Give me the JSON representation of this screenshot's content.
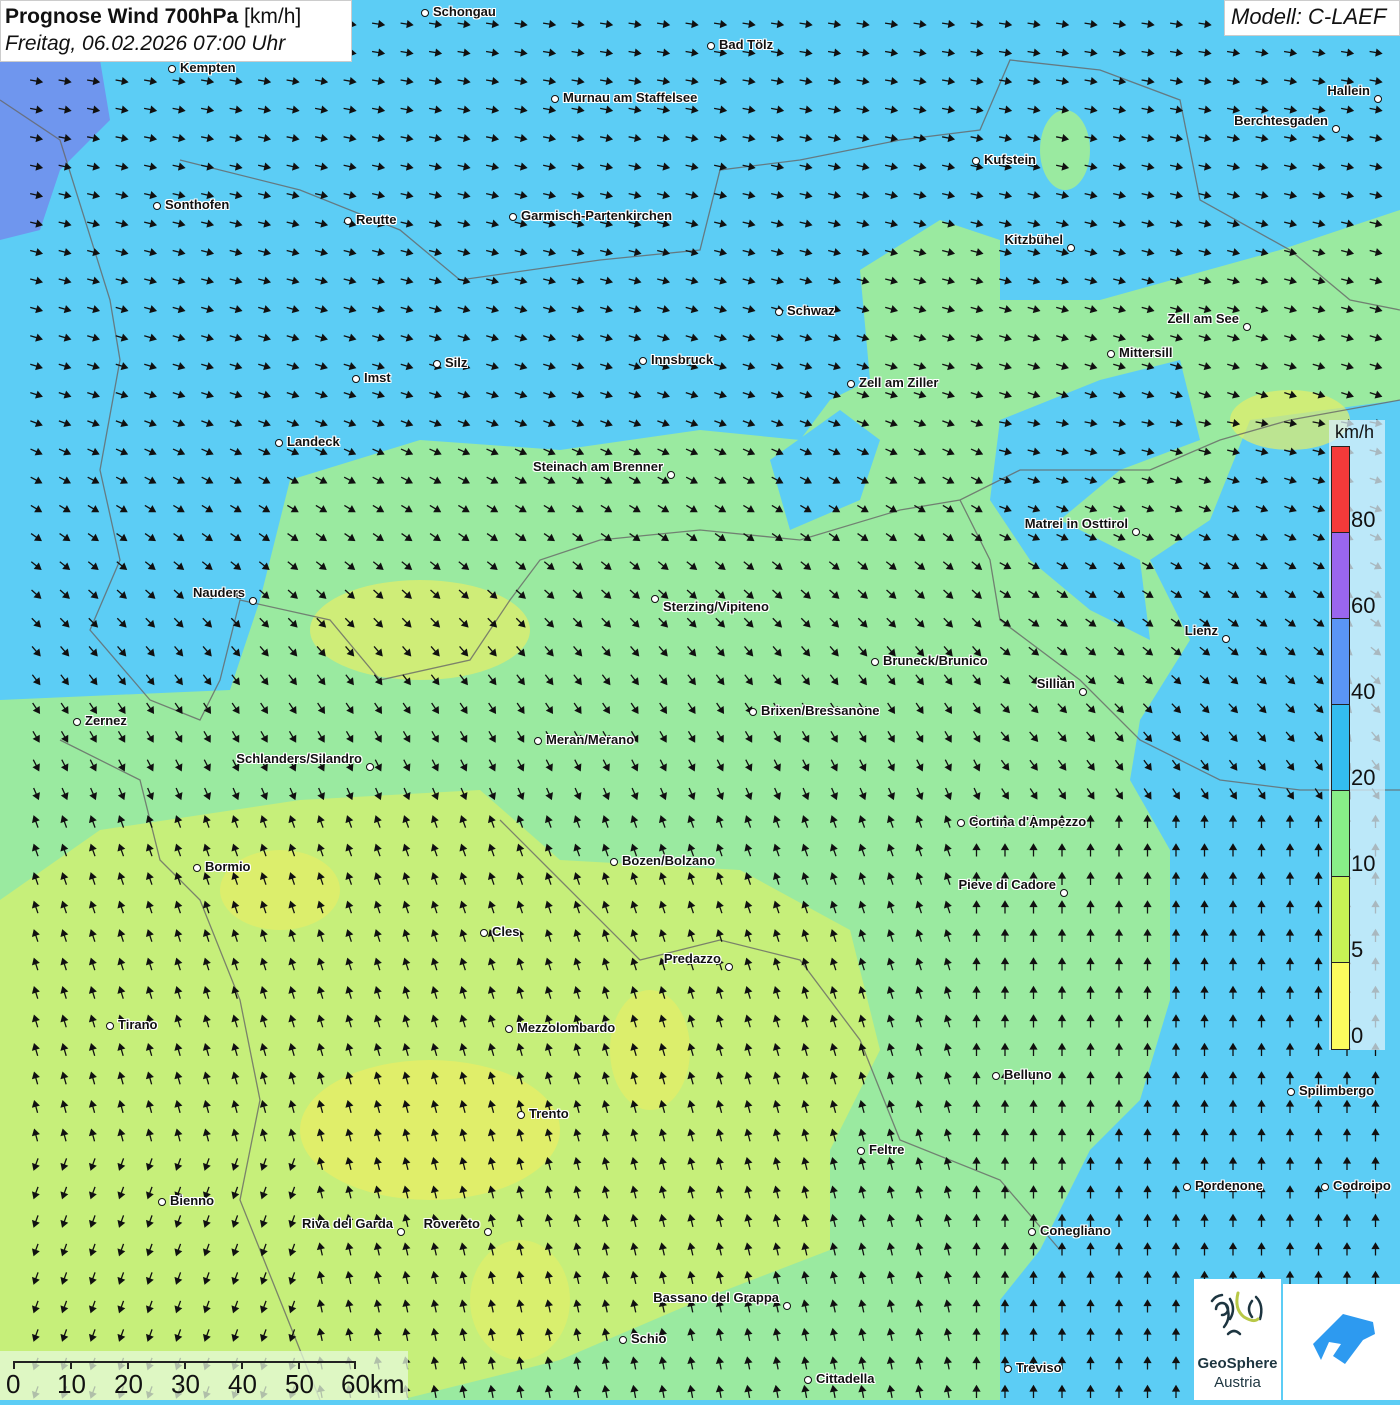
{
  "header": {
    "title_bold": "Prognose Wind 700hPa",
    "title_unit": "[km/h]",
    "datetime": "Freitag, 06.02.2026 07:00 Uhr",
    "model": "Modell: C-LAEF"
  },
  "legend": {
    "unit": "km/h",
    "ticks": [
      "80",
      "60",
      "40",
      "20",
      "10",
      "5",
      "0"
    ],
    "colors": [
      "#f43a3a",
      "#9a66ee",
      "#5a95f5",
      "#33bdf0",
      "#88ee88",
      "#c8f255",
      "#fcfc5e"
    ]
  },
  "scale": {
    "labels": [
      "0",
      "10",
      "20",
      "30",
      "40",
      "50",
      "60km"
    ]
  },
  "logos": {
    "geosphere_line1": "GeoSphere",
    "geosphere_line2": "Austria"
  },
  "cities": [
    "Schongau",
    "Bad Tölz",
    "Kempten",
    "Murnau am Staffelsee",
    "Hallein",
    "Berchtesgaden",
    "Kufstein",
    "Sonthofen",
    "Reutte",
    "Garmisch-Partenkirchen",
    "Kitzbühel",
    "Schwaz",
    "Zell am See",
    "Innsbruck",
    "Mittersill",
    "Silz",
    "Imst",
    "Zell am Ziller",
    "Landeck",
    "Steinach am Brenner",
    "Matrei in Osttirol",
    "Nauders",
    "Sterzing/Vipiteno",
    "Lienz",
    "Bruneck/Brunico",
    "Sillian",
    "Brixen/Bressanone",
    "Zernez",
    "Meran/Merano",
    "Schlanders/Silandro",
    "Cortina d'Ampezzo",
    "Bozen/Bolzano",
    "Bormio",
    "Pieve di Cadore",
    "Cles",
    "Predazzo",
    "Tirano",
    "Mezzolombardo",
    "Belluno",
    "Spilimbergo",
    "Trento",
    "Feltre",
    "Pordenone",
    "Codroipo",
    "Bienno",
    "Riva del Garda",
    "Rovereto",
    "Conegliano",
    "Bassano del Grappa",
    "Schio",
    "Treviso",
    "Cittadella"
  ]
}
